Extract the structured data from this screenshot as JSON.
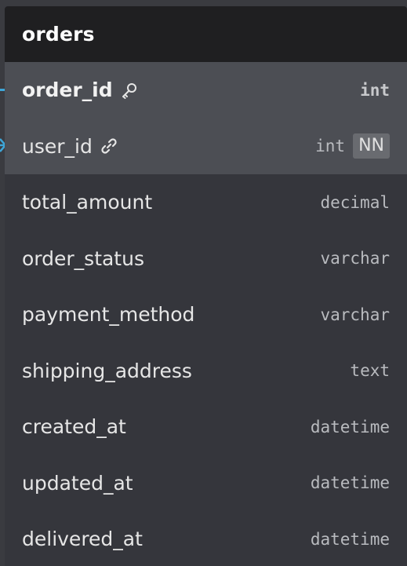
{
  "table": {
    "name": "orders",
    "columns": [
      {
        "name": "order_id",
        "type": "int",
        "icon": "key-icon",
        "primary_key": true,
        "not_null": false
      },
      {
        "name": "user_id",
        "type": "int",
        "icon": "link-icon",
        "primary_key": false,
        "not_null": true,
        "nn_label": "NN"
      },
      {
        "name": "total_amount",
        "type": "decimal"
      },
      {
        "name": "order_status",
        "type": "varchar"
      },
      {
        "name": "payment_method",
        "type": "varchar"
      },
      {
        "name": "shipping_address",
        "type": "text"
      },
      {
        "name": "created_at",
        "type": "datetime"
      },
      {
        "name": "updated_at",
        "type": "datetime"
      },
      {
        "name": "delivered_at",
        "type": "datetime"
      }
    ]
  },
  "colors": {
    "background": "#3a3b40",
    "header": "#1f1f21",
    "row": "#35363c",
    "key_row": "#4c4e54",
    "connector": "#3ea6d8"
  }
}
